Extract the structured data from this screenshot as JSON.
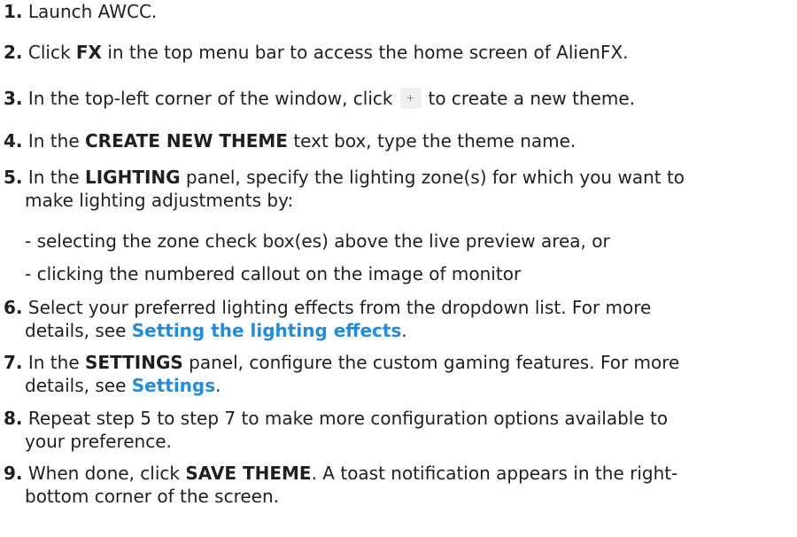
{
  "steps": [
    {
      "num": "1.",
      "text": "Launch AWCC."
    },
    {
      "num": "2.",
      "pre": "Click ",
      "bold": "FX",
      "post": " in the top menu bar to access the home screen of AlienFX."
    },
    {
      "num": "3.",
      "pre": "In the top-left corner of the window, click",
      "icon": "plus-icon",
      "icon_glyph": "+",
      "post": "to create a new theme."
    },
    {
      "num": "4.",
      "pre": "In the ",
      "bold": "CREATE NEW THEME",
      "post": " text box, type the theme name."
    },
    {
      "num": "5.",
      "pre": "In the ",
      "bold": "LIGHTING",
      "post": " panel, specify the lighting zone(s) for which you want to",
      "line2": "make lighting adjustments by:"
    },
    {
      "num": "6.",
      "line1": "Select your preferred lighting effects from the dropdown list. For more",
      "line2_pre": "details, see ",
      "link": "Setting the lighting effects",
      "line2_post": "."
    },
    {
      "num": "7.",
      "pre": "In the ",
      "bold": "SETTINGS",
      "post": " panel, configure the custom gaming features. For more",
      "line2_pre": "details, see ",
      "link": "Settings",
      "line2_post": "."
    },
    {
      "num": "8.",
      "line1": "Repeat step 5 to step 7 to make more configuration options available to",
      "line2": "your preference."
    },
    {
      "num": "9.",
      "pre": "When done, click ",
      "bold": "SAVE THEME",
      "post": ". A toast notification appears in the right-",
      "line2": "bottom corner of the screen."
    }
  ],
  "sub_items": [
    "- selecting the zone check box(es) above the live preview area, or",
    "- clicking the numbered callout on the image of monitor"
  ],
  "colors": {
    "text": "#1f1f1f",
    "link": "#1b8de8",
    "icon_button_bg": "#f0f0f0"
  }
}
